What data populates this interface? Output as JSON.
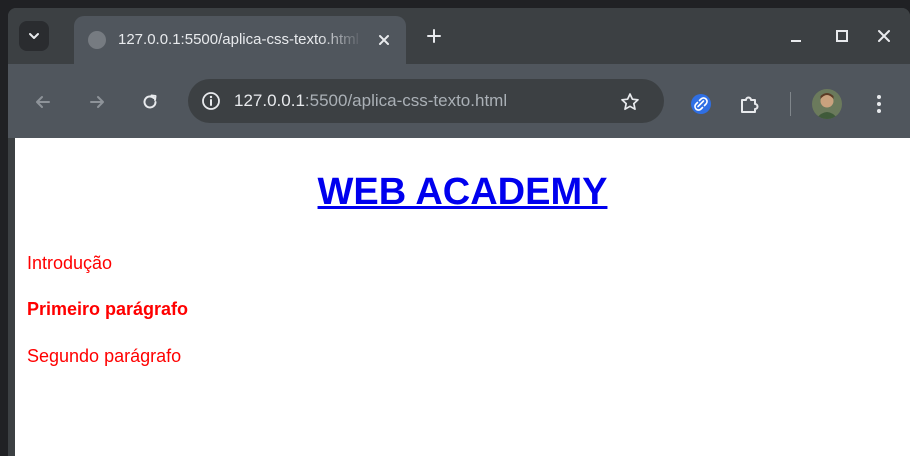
{
  "browser": {
    "tab": {
      "title": "127.0.0.1:5500/aplica-css-texto.html"
    },
    "address": {
      "host": "127.0.0.1",
      "rest": ":5500/aplica-css-texto.html"
    },
    "icons": {
      "tab_search": "chevron-down-icon",
      "favicon": "globe-icon",
      "tab_close": "close-icon",
      "new_tab": "plus-icon",
      "minimize": "minimize-icon",
      "maximize": "maximize-icon",
      "close_window": "close-icon",
      "back": "arrow-left-icon",
      "forward": "arrow-right-icon",
      "reload": "reload-icon",
      "site_info": "info-icon",
      "bookmark": "star-icon",
      "extension_link": "link-icon",
      "extensions": "puzzle-icon",
      "profile": "avatar",
      "menu": "kebab-menu-icon"
    },
    "colors": {
      "frame": "#3c4043",
      "toolbar": "#50565d",
      "text": "#e8eaed"
    }
  },
  "page": {
    "heading": "WEB ACADEMY",
    "paragraphs": [
      {
        "text": "Introdução",
        "bold": false
      },
      {
        "text": "Primeiro parágrafo",
        "bold": true
      },
      {
        "text": "Segundo parágrafo",
        "bold": false
      }
    ],
    "colors": {
      "heading": "#0000ee",
      "paragraph": "#ff0000"
    }
  }
}
